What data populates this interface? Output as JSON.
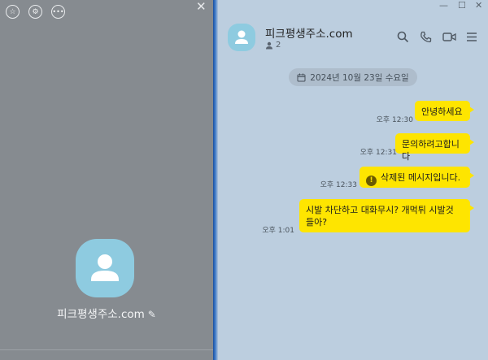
{
  "left_panel": {
    "icons": [
      "star-icon",
      "settings-icon",
      "more-icon"
    ],
    "close_label": "✕",
    "profile_name": "피크평생주소.com"
  },
  "chat": {
    "title": "피크평생주소.com",
    "member_count": "2",
    "date": "2024년 10월 23일 수요일",
    "window_controls": [
      "—",
      "☐",
      "✕"
    ],
    "messages": [
      {
        "text": "안녕하세요",
        "time": "오후 12:30"
      },
      {
        "text": "문의하려고합니다",
        "time": "오후 12:31"
      },
      {
        "text": "삭제된 메시지입니다.",
        "time": "오후 12:33",
        "deleted": true
      },
      {
        "text": "시발 차단하고 대화무시? 개먹튀 시발것 들아?",
        "time": "오후 1:01"
      }
    ]
  }
}
